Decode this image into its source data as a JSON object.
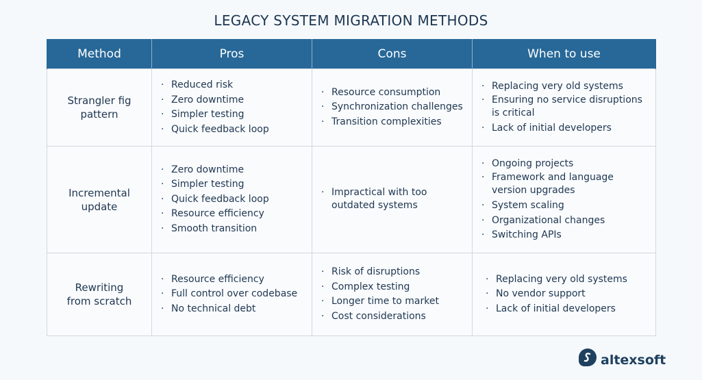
{
  "title": "LEGACY SYSTEM MIGRATION METHODS",
  "columns": [
    "Method",
    "Pros",
    "Cons",
    "When to use"
  ],
  "rows": [
    {
      "method": [
        "Strangler fig",
        "pattern"
      ],
      "pros": [
        "Reduced risk",
        "Zero downtime",
        "Simpler testing",
        "Quick feedback loop"
      ],
      "cons": [
        "Resource consumption",
        "Synchronization challenges",
        "Transition complexities"
      ],
      "when": [
        "Replacing very old systems",
        "Ensuring no service disruptions is critical",
        "Lack of initial developers"
      ]
    },
    {
      "method": [
        "Incremental",
        "update"
      ],
      "pros": [
        "Zero downtime",
        "Simpler testing",
        "Quick feedback loop",
        "Resource efficiency",
        "Smooth transition"
      ],
      "cons": [
        "Impractical with too outdated systems"
      ],
      "when": [
        "Ongoing projects",
        "Framework and language version upgrades",
        "System scaling",
        "Organizational changes",
        "Switching APIs"
      ]
    },
    {
      "method": [
        "Rewriting",
        "from scratch"
      ],
      "pros": [
        "Resource efficiency",
        "Full control over codebase",
        "No technical debt"
      ],
      "cons": [
        "Risk of disruptions",
        "Complex testing",
        "Longer time to market",
        "Cost considerations"
      ],
      "when": [
        "Replacing very old systems",
        "No vendor support",
        "Lack of initial developers"
      ]
    }
  ],
  "logo": {
    "text": "altexsoft",
    "icon": "altexsoft-logo-icon"
  },
  "colors": {
    "header_bg": "#276898",
    "text": "#1f3650",
    "background": "#f6f9fc"
  }
}
